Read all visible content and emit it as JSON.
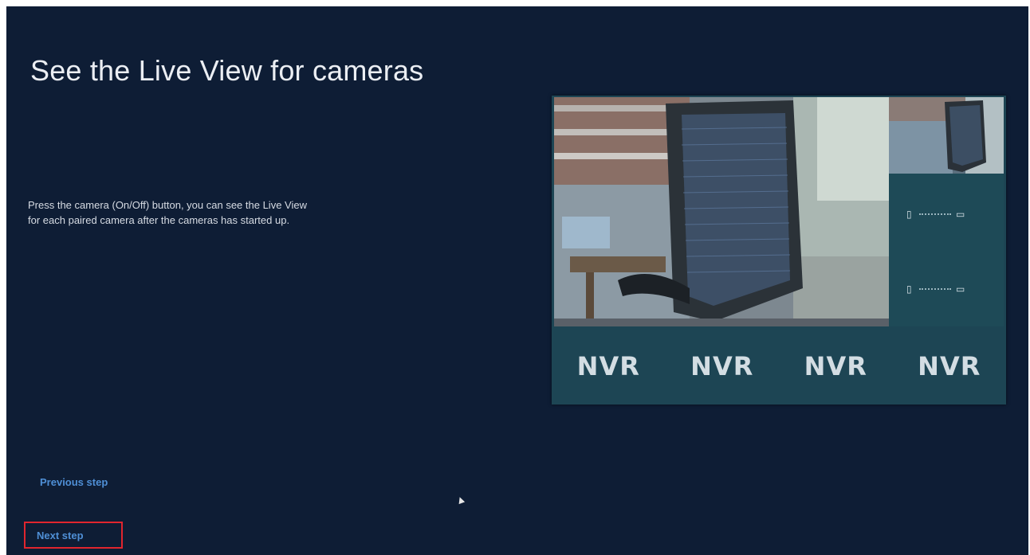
{
  "page": {
    "title": "See the Live View for cameras",
    "instruction_line1": "Press the camera (On/Off) button, you can see the Live View",
    "instruction_line2": "for each paired camera after the cameras has started up."
  },
  "preview": {
    "nvr_labels": [
      "NVR",
      "NVR",
      "NVR",
      "NVR"
    ],
    "link_indicators": [
      {
        "camera_icon": "camera-icon",
        "nvr_icon": "monitor-icon"
      },
      {
        "camera_icon": "camera-icon",
        "nvr_icon": "monitor-icon"
      }
    ]
  },
  "nav": {
    "previous_label": "Previous step",
    "next_label": "Next step"
  },
  "colors": {
    "background": "#0e1d35",
    "panel": "#1d4554",
    "link": "#4f8fd6",
    "highlight": "#e0252e"
  }
}
